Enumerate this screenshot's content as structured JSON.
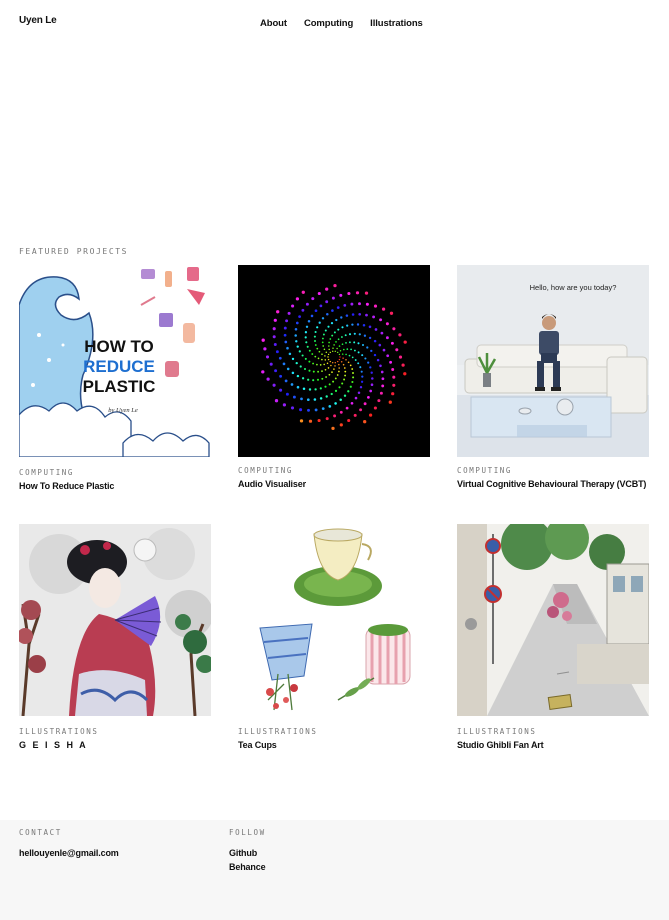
{
  "header": {
    "site_name": "Uyen Le",
    "nav": [
      "About",
      "Computing",
      "Illustrations"
    ]
  },
  "section": {
    "label": "FEATURED PROJECTS"
  },
  "projects": [
    {
      "category": "COMPUTING",
      "title": "How To Reduce Plastic",
      "thumb_text": [
        "HOW TO",
        "REDUCE",
        "PLASTIC",
        "by Uyen Le"
      ]
    },
    {
      "category": "COMPUTING",
      "title": "Audio Visualiser"
    },
    {
      "category": "COMPUTING",
      "title": "Virtual Cognitive Behavioural Therapy (VCBT)",
      "thumb_text": [
        "Hello, how are you today?"
      ]
    },
    {
      "category": "ILLUSTRATIONS",
      "title": "G E I S H A"
    },
    {
      "category": "ILLUSTRATIONS",
      "title": "Tea Cups"
    },
    {
      "category": "ILLUSTRATIONS",
      "title": "Studio Ghibli Fan Art"
    }
  ],
  "footer": {
    "contact_label": "CONTACT",
    "email": "hellouyenle@gmail.com",
    "follow_label": "FOLLOW",
    "links": [
      "Github",
      "Behance"
    ]
  }
}
